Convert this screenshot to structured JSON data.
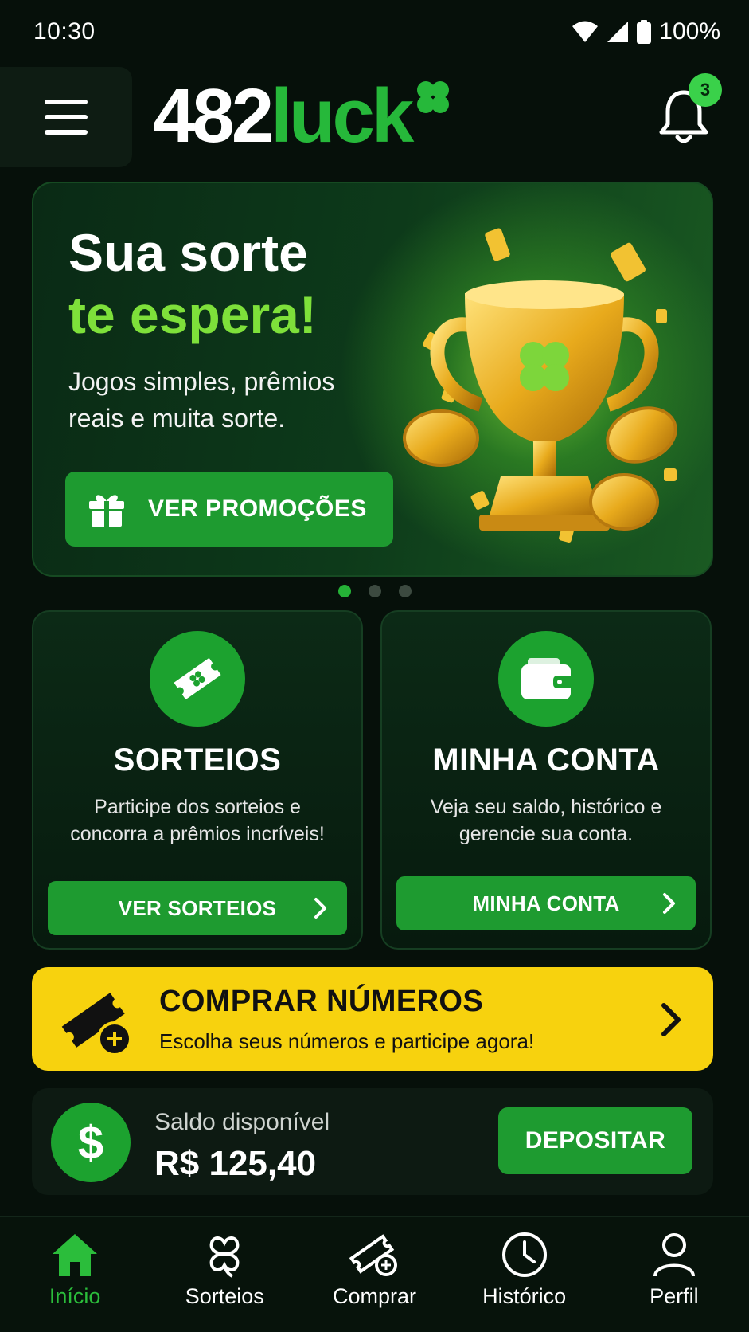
{
  "status_bar": {
    "time": "10:30",
    "battery": "100%"
  },
  "header": {
    "logo_number": "482",
    "logo_word": "luck",
    "notification_count": "3"
  },
  "hero": {
    "title_line1": "Sua sorte",
    "title_line2": "te espera!",
    "subtitle": "Jogos simples, prêmios reais e muita sorte.",
    "button_label": "VER PROMOÇÕES",
    "carousel_total": 3,
    "carousel_active": 1
  },
  "cards": {
    "draws": {
      "title": "SORTEIOS",
      "description": "Participe dos sorteios e concorra a prêmios incríveis!",
      "button_label": "VER SORTEIOS"
    },
    "account": {
      "title": "MINHA CONTA",
      "description": "Veja seu saldo, histórico e gerencie sua conta.",
      "button_label": "MINHA CONTA"
    }
  },
  "buy_banner": {
    "title": "COMPRAR NÚMEROS",
    "subtitle": "Escolha seus números e participe agora!"
  },
  "balance": {
    "label": "Saldo disponível",
    "value": "R$ 125,40",
    "icon_symbol": "$",
    "button_label": "DEPOSITAR"
  },
  "bottom_nav": {
    "items": [
      {
        "label": "Início",
        "icon": "home-icon",
        "active": true
      },
      {
        "label": "Sorteios",
        "icon": "clover-icon",
        "active": false
      },
      {
        "label": "Comprar",
        "icon": "ticket-add-icon",
        "active": false
      },
      {
        "label": "Histórico",
        "icon": "clock-icon",
        "active": false
      },
      {
        "label": "Perfil",
        "icon": "user-icon",
        "active": false
      }
    ]
  },
  "colors": {
    "background": "#06100a",
    "brand_green": "#1e9b30",
    "accent_lime": "#7ee03a",
    "banner_yellow": "#f7d20e"
  }
}
